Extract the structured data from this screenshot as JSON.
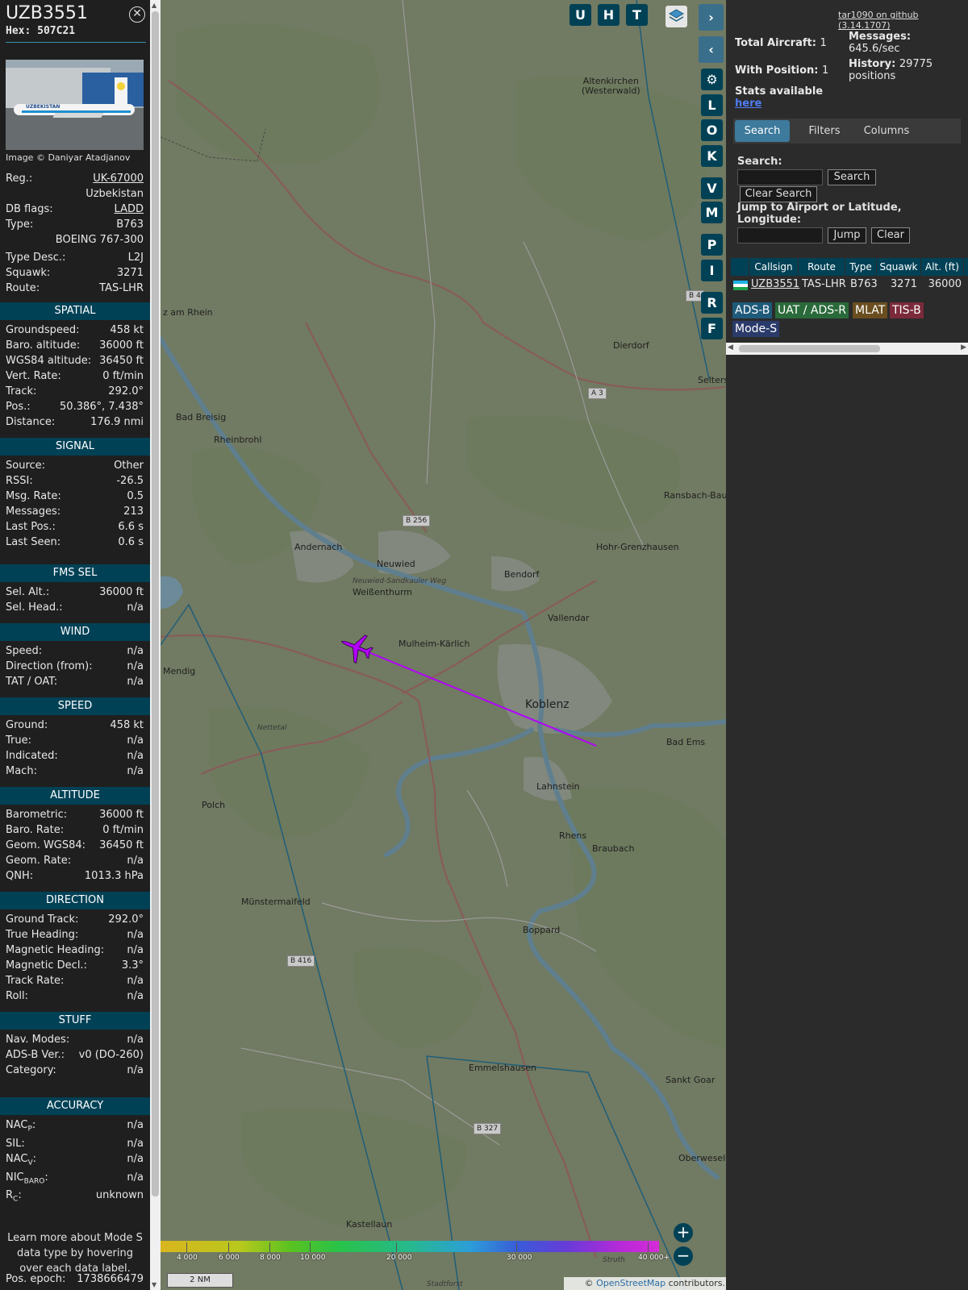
{
  "aircraft": {
    "callsign": "UZB3551",
    "hex": "Hex: 507C21",
    "photo_credit": "Image © Daniyar Atadjanov",
    "photo_brand": "UZBEKISTAN",
    "basic": [
      {
        "label": "Reg.:",
        "value": "UK-67000",
        "link": true
      },
      {
        "label": "",
        "value": "Uzbekistan"
      },
      {
        "label": "DB flags:",
        "value": "LADD",
        "link": true
      },
      {
        "label": "Type:",
        "value": "B763"
      },
      {
        "label": "",
        "value": "BOEING 767-300"
      },
      {
        "label": "Type Desc.:",
        "value": "L2J"
      },
      {
        "label": "Squawk:",
        "value": "3271"
      },
      {
        "label": "Route:",
        "value": "TAS-LHR"
      }
    ],
    "sections": [
      {
        "title": "SPATIAL",
        "rows": [
          {
            "label": "Groundspeed:",
            "value": "458 kt"
          },
          {
            "label": "Baro. altitude:",
            "value": "36000 ft"
          },
          {
            "label": "WGS84 altitude:",
            "value": "36450 ft"
          },
          {
            "label": "Vert. Rate:",
            "value": "0 ft/min"
          },
          {
            "label": "Track:",
            "value": "292.0°"
          },
          {
            "label": "Pos.:",
            "value": "50.386°, 7.438°"
          },
          {
            "label": "Distance:",
            "value": "176.9 nmi"
          }
        ]
      },
      {
        "title": "SIGNAL",
        "rows": [
          {
            "label": "Source:",
            "value": "Other"
          },
          {
            "label": "RSSI:",
            "value": "-26.5"
          },
          {
            "label": "Msg. Rate:",
            "value": "0.5"
          },
          {
            "label": "Messages:",
            "value": "213"
          },
          {
            "label": "Last Pos.:",
            "value": "6.6 s"
          },
          {
            "label": "Last Seen:",
            "value": "0.6 s"
          }
        ]
      },
      {
        "title": "FMS SEL",
        "rows": [
          {
            "label": "Sel. Alt.:",
            "value": "36000 ft"
          },
          {
            "label": "Sel. Head.:",
            "value": "n/a"
          }
        ]
      },
      {
        "title": "WIND",
        "rows": [
          {
            "label": "Speed:",
            "value": "n/a"
          },
          {
            "label": "Direction (from):",
            "value": "n/a"
          },
          {
            "label": "TAT / OAT:",
            "value": "n/a"
          }
        ]
      },
      {
        "title": "SPEED",
        "rows": [
          {
            "label": "Ground:",
            "value": "458 kt"
          },
          {
            "label": "True:",
            "value": "n/a"
          },
          {
            "label": "Indicated:",
            "value": "n/a"
          },
          {
            "label": "Mach:",
            "value": "n/a"
          }
        ]
      },
      {
        "title": "ALTITUDE",
        "rows": [
          {
            "label": "Barometric:",
            "value": "36000 ft"
          },
          {
            "label": "Baro. Rate:",
            "value": "0 ft/min"
          },
          {
            "label": "Geom. WGS84:",
            "value": "36450 ft"
          },
          {
            "label": "Geom. Rate:",
            "value": "n/a"
          },
          {
            "label": "QNH:",
            "value": "1013.3 hPa"
          }
        ]
      },
      {
        "title": "DIRECTION",
        "rows": [
          {
            "label": "Ground Track:",
            "value": "292.0°"
          },
          {
            "label": "True Heading:",
            "value": "n/a"
          },
          {
            "label": "Magnetic Heading:",
            "value": "n/a"
          },
          {
            "label": "Magnetic Decl.:",
            "value": "3.3°"
          },
          {
            "label": "Track Rate:",
            "value": "n/a"
          },
          {
            "label": "Roll:",
            "value": "n/a"
          }
        ]
      },
      {
        "title": "STUFF",
        "rows": [
          {
            "label": "Nav. Modes:",
            "value": "n/a"
          },
          {
            "label": "ADS-B Ver.:",
            "value": "v0 (DO-260)"
          },
          {
            "label": "Category:",
            "value": "n/a"
          }
        ]
      },
      {
        "title": "ACCURACY",
        "rows": [
          {
            "label": "NAC",
            "sub": "P",
            "suffix": ":",
            "value": "n/a"
          },
          {
            "label": "SIL:",
            "value": "n/a"
          },
          {
            "label": "NAC",
            "sub": "V",
            "suffix": ":",
            "value": "n/a"
          },
          {
            "label": "NIC",
            "sub": "BARO",
            "suffix": ":",
            "value": "n/a"
          },
          {
            "label": "R",
            "sub": "C",
            "suffix": ":",
            "value": "unknown"
          }
        ]
      }
    ],
    "learn_more": "Learn more about Mode S data type by hovering over each data label.",
    "pos_epoch": {
      "label": "Pos. epoch:",
      "value": "1738666479"
    }
  },
  "map": {
    "buttons_top": [
      "U",
      "H",
      "T"
    ],
    "buttons_side": [
      "L",
      "O",
      "K",
      "V",
      "M",
      "P",
      "I",
      "R",
      "F"
    ],
    "towns": [
      {
        "name": "Altenkirchen\n(Westerwald)"
      },
      {
        "name": "Dierdorf"
      },
      {
        "name": "Selters"
      },
      {
        "name": "Ransbach-Baum"
      },
      {
        "name": "Hohr-Grenzhausen"
      },
      {
        "name": "Bendorf"
      },
      {
        "name": "Vallendar"
      },
      {
        "name": "Koblenz"
      },
      {
        "name": "Bad Ems"
      },
      {
        "name": "Lahnstein"
      },
      {
        "name": "Rhens"
      },
      {
        "name": "Braubach"
      },
      {
        "name": "Boppard"
      },
      {
        "name": "Emmelshausen"
      },
      {
        "name": "Sankt Goar"
      },
      {
        "name": "Oberwesel"
      },
      {
        "name": "Kastellaun"
      },
      {
        "name": "Münstermaifeld"
      },
      {
        "name": "Polch"
      },
      {
        "name": "Mendig"
      },
      {
        "name": "Andernach"
      },
      {
        "name": "Neuwied"
      },
      {
        "name": "Weißenthurm"
      },
      {
        "name": "Mulheim-Kärlich"
      },
      {
        "name": "Bad Breisig"
      },
      {
        "name": "Rheinbrohl"
      },
      {
        "name": "z am Rhein"
      },
      {
        "name": "Nettetal"
      },
      {
        "name": "Neuwied-Sandkauler Weg"
      },
      {
        "name": "Stadtforst"
      },
      {
        "name": "Struth"
      }
    ],
    "road_shields": [
      {
        "name": "B 256"
      },
      {
        "name": "A 3"
      },
      {
        "name": "B 416"
      },
      {
        "name": "B 327"
      },
      {
        "name": "B 4"
      }
    ],
    "color_scale": [
      "4 000",
      "6 000",
      "8 000",
      "10 000",
      "20 000",
      "30 000",
      "40 000+"
    ],
    "scale_label": "2 NM",
    "attribution_pre": "©",
    "attribution_link": "OpenStreetMap",
    "attribution_post": "contributors."
  },
  "panel": {
    "version": "tar1090 on github (3.14.1707)",
    "total_aircraft_label": "Total Aircraft:",
    "total_aircraft": "1",
    "with_position_label": "With Position:",
    "with_position": "1",
    "stats_label": "Stats available",
    "stats_link": "here",
    "messages_label": "Messages:",
    "messages_value": "645.6/sec",
    "history_label": "History:",
    "history_value": "29775",
    "history_unit": "positions",
    "tabs": [
      "Search",
      "Filters",
      "Columns"
    ],
    "search_label": "Search:",
    "search_button": "Search",
    "clear_search_button": "Clear Search",
    "jump_label": "Jump to Airport or Latitude, Longitude:",
    "jump_button": "Jump",
    "clear_button": "Clear",
    "table": {
      "columns": [
        "Callsign",
        "Route",
        "Type",
        "Squawk",
        "Alt. (ft)"
      ],
      "rows": [
        [
          "UZB3551",
          "TAS-LHR",
          "B763",
          "3271",
          "36000"
        ]
      ]
    },
    "sources": [
      {
        "label": "ADS-B",
        "color": "#1f5a7a"
      },
      {
        "label": "UAT / ADS-R",
        "color": "#2a6a3a"
      },
      {
        "label": "MLAT",
        "color": "#6a4e1f"
      },
      {
        "label": "TIS-B",
        "color": "#7a2a3a"
      },
      {
        "label": "Mode-S",
        "color": "#2a3a6a"
      }
    ]
  }
}
